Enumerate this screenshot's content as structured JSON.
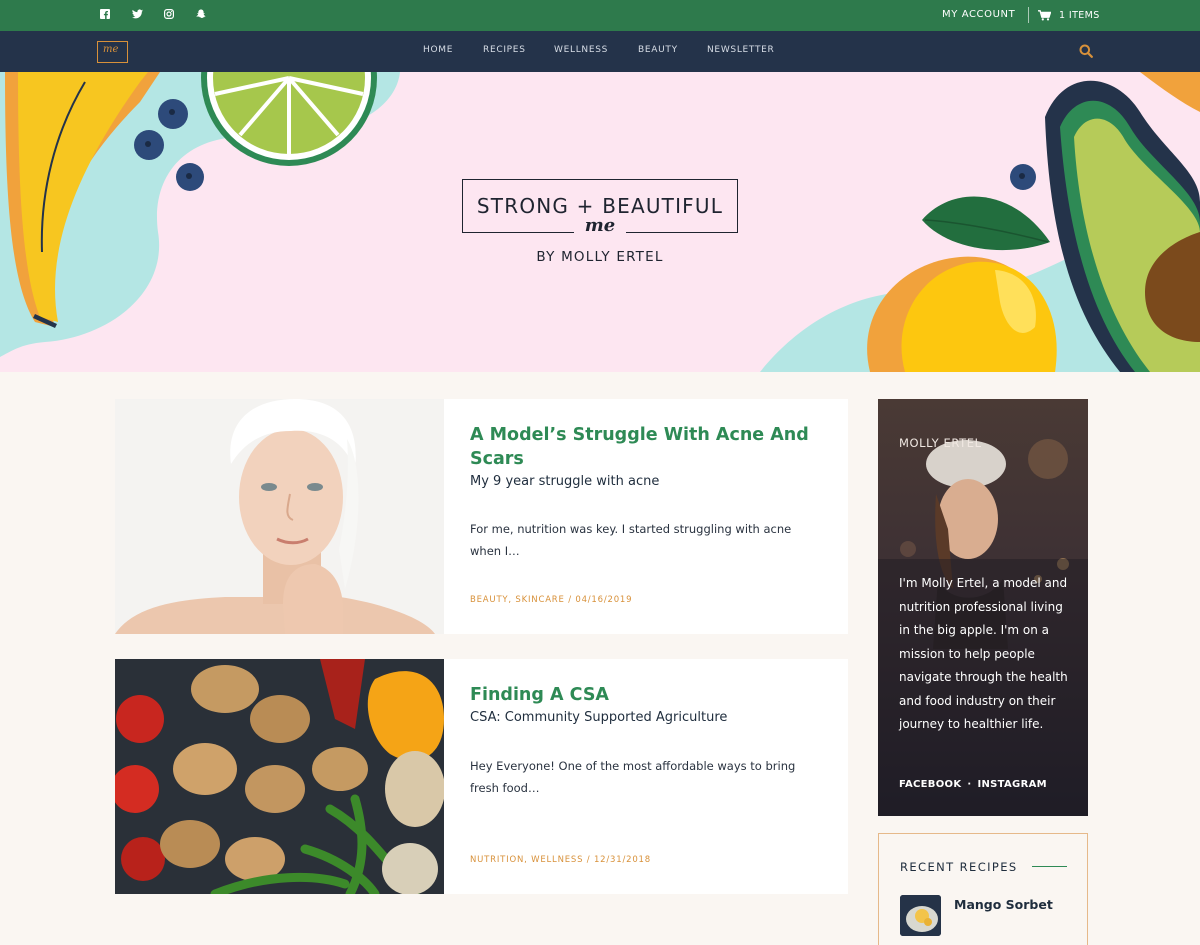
{
  "topbar": {
    "social_icons": [
      "facebook-icon",
      "twitter-icon",
      "instagram-icon",
      "snapchat-icon"
    ],
    "account_label": "MY ACCOUNT",
    "cart_icon": "cart-icon",
    "cart_label": "1 ITEMS"
  },
  "nav": {
    "logo_text": "me",
    "items": [
      "HOME",
      "RECIPES",
      "WELLNESS",
      "BEAUTY",
      "NEWSLETTER"
    ],
    "search_icon": "search-icon"
  },
  "hero": {
    "title": "STRONG + BEAUTIFUL",
    "script": "me",
    "byline": "BY MOLLY ERTEL"
  },
  "posts": [
    {
      "title": "A Model’s Struggle With Acne And Scars",
      "subtitle": "My 9 year struggle with acne",
      "excerpt": "For me, nutrition was key. I started struggling with acne when I…",
      "meta": "BEAUTY, SKINCARE / 04/16/2019"
    },
    {
      "title": "Finding A CSA",
      "subtitle": "CSA: Community Supported Agriculture",
      "excerpt": "Hey Everyone! One of the most affordable ways to bring fresh food…",
      "meta": "NUTRITION, WELLNESS / 12/31/2018"
    }
  ],
  "sidebar": {
    "about": {
      "name": "MOLLY ERTEL",
      "bio": "I'm Molly Ertel, a model and nutrition professional living in the big apple. I'm on a mission to help people navigate through the health and food industry on their journey to healthier life.",
      "links": [
        "FACEBOOK",
        "INSTAGRAM"
      ],
      "separator": "·"
    },
    "recent": {
      "heading": "RECENT RECIPES",
      "items": [
        "Mango Sorbet"
      ]
    }
  },
  "colors": {
    "topbar": "#2e7a4c",
    "navbar": "#24334a",
    "accent_orange": "#d8913a",
    "title_green": "#2e8a55",
    "hero_pink": "#fde6f1"
  }
}
